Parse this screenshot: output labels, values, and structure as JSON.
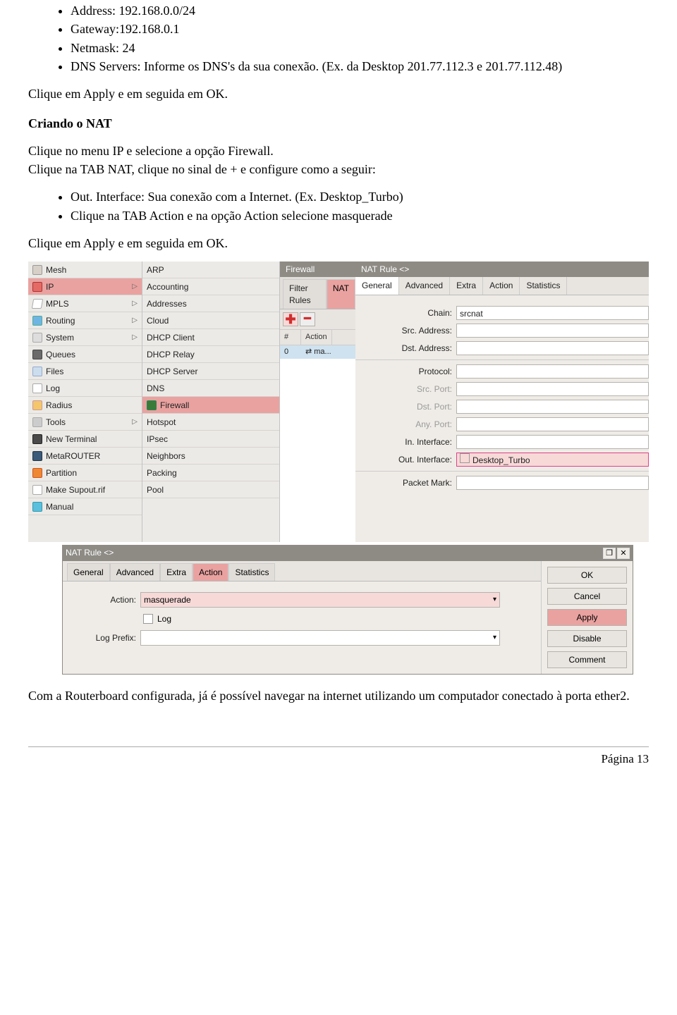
{
  "top_bullets": [
    "Address: 192.168.0.0/24",
    "Gateway:192.168.0.1",
    "Netmask: 24",
    "DNS Servers: Informe os DNS's da sua conexão. (Ex. da Desktop 201.77.112.3 e 201.77.112.48)"
  ],
  "p_apply1": "Clique em Apply e em seguida em OK.",
  "h_nat": "Criando o NAT",
  "p_fw1": "Clique no menu IP e selecione a opção Firewall.",
  "p_fw2": "Clique na TAB NAT, clique no sinal de + e configure como a seguir:",
  "nat_bullets": [
    "Out. Interface: Sua conexão com a Internet. (Ex. Desktop_Turbo)",
    "Clique na TAB Action e na opção Action selecione masquerade"
  ],
  "p_apply2": "Clique em Apply e em seguida em OK.",
  "shot1": {
    "left_items": [
      {
        "icon": "ic-mesh",
        "label": "Mesh",
        "chev": false
      },
      {
        "icon": "ic-ip",
        "label": "IP",
        "chev": true,
        "sel": true
      },
      {
        "icon": "ic-mpls",
        "label": "MPLS",
        "chev": true
      },
      {
        "icon": "ic-route",
        "label": "Routing",
        "chev": true
      },
      {
        "icon": "ic-sys",
        "label": "System",
        "chev": true
      },
      {
        "icon": "ic-queue",
        "label": "Queues"
      },
      {
        "icon": "ic-files",
        "label": "Files"
      },
      {
        "icon": "ic-log",
        "label": "Log"
      },
      {
        "icon": "ic-radius",
        "label": "Radius"
      },
      {
        "icon": "ic-tools",
        "label": "Tools",
        "chev": true
      },
      {
        "icon": "ic-term",
        "label": "New Terminal"
      },
      {
        "icon": "ic-meta",
        "label": "MetaROUTER"
      },
      {
        "icon": "ic-part",
        "label": "Partition"
      },
      {
        "icon": "ic-supout",
        "label": "Make Supout.rif"
      },
      {
        "icon": "ic-man",
        "label": "Manual"
      }
    ],
    "mid_items": [
      "ARP",
      "Accounting",
      "Addresses",
      "Cloud",
      "DHCP Client",
      "DHCP Relay",
      "DHCP Server",
      "DNS",
      "Firewall",
      "Hotspot",
      "IPsec",
      "Neighbors",
      "Packing",
      "Pool"
    ],
    "mid_selected_index": 8,
    "fw_title": "Firewall",
    "fw_tabs": [
      "Filter Rules",
      "NAT"
    ],
    "fw_active_tab": 1,
    "listhead": [
      "#",
      "Action"
    ],
    "row0": [
      "0",
      "⇄ ma..."
    ],
    "rule_title": "NAT Rule <>",
    "rule_tabs": [
      "General",
      "Advanced",
      "Extra",
      "Action",
      "Statistics"
    ],
    "rule_active_tab": 0,
    "fields": {
      "chain_label": "Chain:",
      "chain_value": "srcnat",
      "src_label": "Src. Address:",
      "dst_label": "Dst. Address:",
      "proto_label": "Protocol:",
      "srcport_label": "Src. Port:",
      "dstport_label": "Dst. Port:",
      "anyport_label": "Any. Port:",
      "iniface_label": "In. Interface:",
      "outiface_label": "Out. Interface:",
      "outiface_value": "Desktop_Turbo",
      "pmark_label": "Packet Mark:"
    }
  },
  "shot2": {
    "title": "NAT Rule <>",
    "tabs": [
      "General",
      "Advanced",
      "Extra",
      "Action",
      "Statistics"
    ],
    "active_tab": 3,
    "action_label": "Action:",
    "action_value": "masquerade",
    "log_label": "Log",
    "logprefix_label": "Log Prefix:",
    "buttons": [
      "OK",
      "Cancel",
      "Apply",
      "Disable",
      "Comment"
    ],
    "hl_button_index": 2
  },
  "closing": "Com a Routerboard configurada, já é possível navegar na internet utilizando um computador conectado à porta ether2.",
  "page_footer": "Página 13"
}
